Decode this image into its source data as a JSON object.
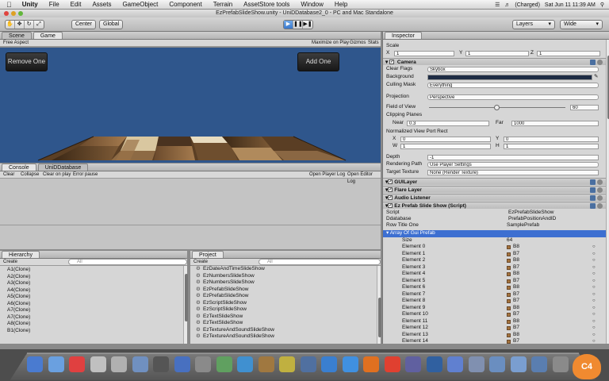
{
  "menubar": {
    "app": "Unity",
    "items": [
      "File",
      "Edit",
      "Assets",
      "GameObject",
      "Component",
      "Terrain",
      "AssetStore tools",
      "Window",
      "Help"
    ],
    "battery": "(Charged)",
    "clock": "Sat Jun 11  11:39 AM"
  },
  "window_title": "EzPrefabSlideShow.unity - UniDDatabase2_0 - PC and Mac Standalone",
  "toolbar": {
    "center": "Center",
    "global": "Global",
    "layers": "Layers",
    "layout": "Wide"
  },
  "scene_tabs": [
    "Scene",
    "Game"
  ],
  "game_bar": {
    "aspect": "Free Aspect",
    "maximize": "Maximize on Play",
    "gizmos": "Gizmos",
    "stats": "Stats"
  },
  "game": {
    "remove_label": "Remove One",
    "add_label": "Add One"
  },
  "console_tabs": [
    "Console",
    "UniDDatabase"
  ],
  "console_bar": [
    "Clear",
    "Collapse",
    "Clear on play",
    "Error pause"
  ],
  "console_right": [
    "Open Player Log",
    "Open Editor Log"
  ],
  "hierarchy": {
    "title": "Hierarchy",
    "create": "Create",
    "search": "All",
    "items": [
      "A1(Clone)",
      "A2(Clone)",
      "A3(Clone)",
      "A4(Clone)",
      "A5(Clone)",
      "A6(Clone)",
      "A7(Clone)",
      "A7(Clone)",
      "A8(Clone)",
      "B1(Clone)"
    ]
  },
  "project": {
    "title": "Project",
    "create": "Create",
    "search": "All",
    "items": [
      "EzDateAndTimeSlideShow",
      "EzNumbersSlideShow",
      "EzNumbersSlideShow",
      "EzPrefabSlideShow",
      "EzPrefabSlideShow",
      "EzScriptSlideShow",
      "EzScriptSlideShow",
      "EzTextSlideShow",
      "EzTextSlideShow",
      "EzTextureAndSoundSlideShow",
      "EzTextureAndSoundSlideShow"
    ]
  },
  "inspector": {
    "title": "Inspector",
    "scale": {
      "label": "Scale",
      "x_label": "X",
      "x": "1",
      "y_label": "Y",
      "y": "1",
      "z_label": "Z",
      "z": "1"
    },
    "camera": {
      "title": "Camera",
      "clear_flags_label": "Clear Flags",
      "clear_flags": "Skybox",
      "background_label": "Background",
      "culling_label": "Culling Mask",
      "culling": "Everything",
      "projection_label": "Projection",
      "projection": "Perspective",
      "fov_label": "Field of View",
      "fov": "60",
      "fov_fraction": 0.5,
      "clipping_label": "Clipping Planes",
      "near_label": "Near",
      "near": "0.3",
      "far_label": "Far",
      "far": "1000",
      "viewport_label": "Normalized View Port Rect",
      "vx_label": "X",
      "vx": "0",
      "vy_label": "Y",
      "vy": "0",
      "vw_label": "W",
      "vw": "1",
      "vh_label": "H",
      "vh": "1",
      "depth_label": "Depth",
      "depth": "-1",
      "rendering_label": "Rendering Path",
      "rendering": "Use Player Settings",
      "target_label": "Target Texture",
      "target": "None (Render Texture)"
    },
    "components": [
      "GUILayer",
      "Flare Layer",
      "Audio Listener"
    ],
    "script_comp": {
      "title": "Ez Prefab Slide Show (Script)",
      "script_label": "Script",
      "script": "EzPrefabSlideShow",
      "ddb_label": "Ddatabase",
      "ddb": "PrefabPositionAndID",
      "row_label": "Row Title One",
      "row": "SamplePrefab",
      "array_label": "Array Of Gui Prefab",
      "size_label": "Size",
      "size": "64"
    },
    "elements": [
      {
        "label": "Element 0",
        "value": "B8"
      },
      {
        "label": "Element 1",
        "value": "B7"
      },
      {
        "label": "Element 2",
        "value": "B8"
      },
      {
        "label": "Element 3",
        "value": "B7"
      },
      {
        "label": "Element 4",
        "value": "B8"
      },
      {
        "label": "Element 5",
        "value": "B7"
      },
      {
        "label": "Element 6",
        "value": "B8"
      },
      {
        "label": "Element 7",
        "value": "B7"
      },
      {
        "label": "Element 8",
        "value": "B7"
      },
      {
        "label": "Element 9",
        "value": "B8"
      },
      {
        "label": "Element 10",
        "value": "B7"
      },
      {
        "label": "Element 11",
        "value": "B8"
      },
      {
        "label": "Element 12",
        "value": "B7"
      },
      {
        "label": "Element 13",
        "value": "B8"
      },
      {
        "label": "Element 14",
        "value": "B7"
      }
    ]
  },
  "watermark": "C4",
  "colors": {
    "game_bg": "#2f568c",
    "selected_row": "#3d6fd1"
  }
}
